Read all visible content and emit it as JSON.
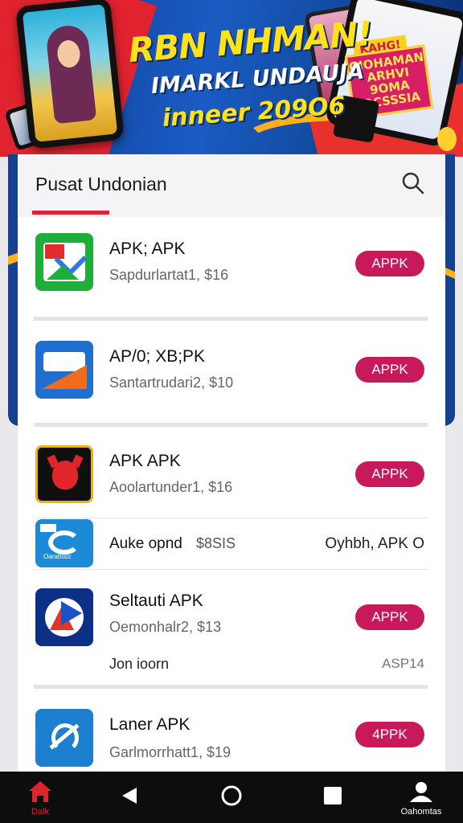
{
  "banner": {
    "headline": "RBN NHMAN!",
    "line2": "IMARKL UNDAUJA",
    "line3": "inneer 209O6",
    "tag": "KAHG!",
    "promo": "GIOHAMAN ARHVI 9OMA OCSSSIA"
  },
  "header": {
    "title": "Pusat Undonian",
    "search_icon": "search-icon"
  },
  "apps": [
    {
      "name": "APK; APK",
      "subtitle": "Sapdurlartat1, $16",
      "button": "APPK",
      "icon": "green-map-icon"
    },
    {
      "name": "AP/0; XB;PK",
      "subtitle": "Santartrudari2, $10",
      "button": "APPK",
      "icon": "orange-blue-icon"
    },
    {
      "name": "APK APK",
      "subtitle": "Aoolartunder1, $16",
      "button": "APPK",
      "icon": "devil-mask-icon"
    },
    {
      "name": "Seltauti APK",
      "subtitle": "Oemonhalr2, $13",
      "button": "APPK",
      "icon": "arrow-logo-icon"
    },
    {
      "name": "Laner APK",
      "subtitle": "Garlmorrhatt1, $19",
      "button": "4PPK",
      "icon": "blue-circle-icon"
    }
  ],
  "promo_row": {
    "left_text": "Auke opnd",
    "price": "$8SIS",
    "right_text": "Oyhbh, APK O",
    "icon_label": "Oarabocc"
  },
  "extra_row": {
    "left_text": "Jon ioorn",
    "right_text": "ASP14"
  },
  "nav": {
    "home_label": "Dalk",
    "profile_label": "Oahomtas"
  },
  "colors": {
    "accent": "#c8195a",
    "tab_underline": "#e0232e",
    "banner_blue": "#1a5cc4",
    "banner_yellow": "#ffe21a"
  }
}
